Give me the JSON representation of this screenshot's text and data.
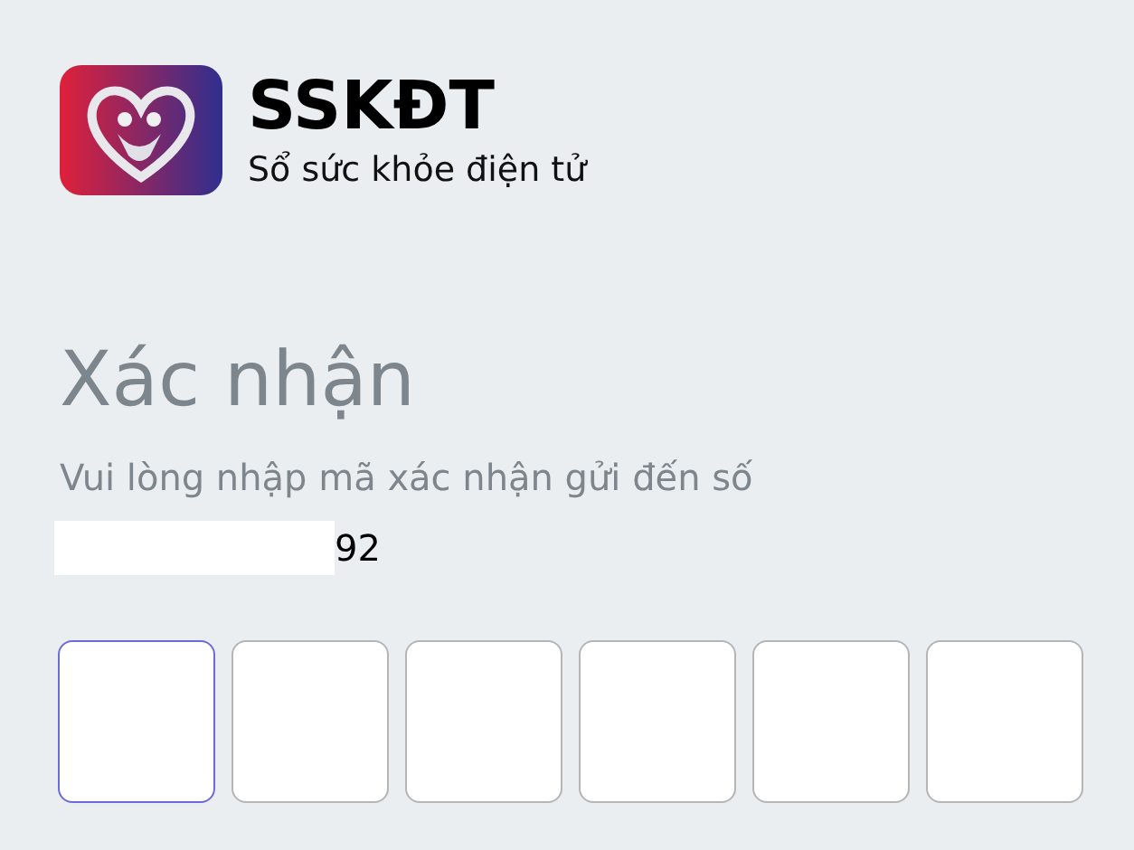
{
  "app": {
    "name": "SSKĐT",
    "tagline": "Sổ sức khỏe điện tử"
  },
  "heading": "Xác nhận",
  "instruction": "Vui lòng nhập mã xác nhận gửi đến số",
  "phone_number": "92",
  "code_boxes": [
    {
      "selected": true
    },
    {
      "selected": false
    },
    {
      "selected": false
    },
    {
      "selected": false
    },
    {
      "selected": false
    },
    {
      "selected": false
    }
  ]
}
